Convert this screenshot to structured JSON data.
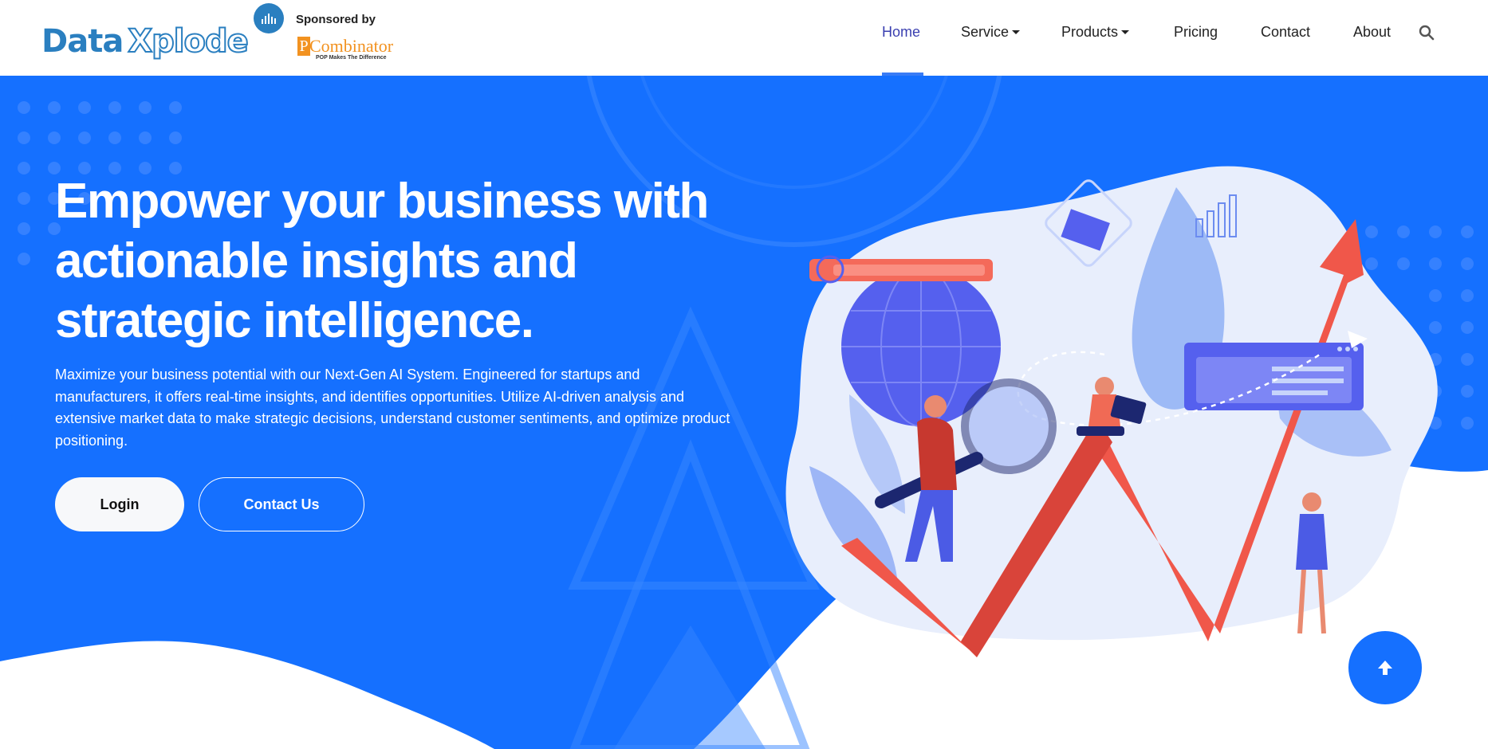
{
  "brand": {
    "logo_word1": "Data",
    "logo_word2": "Xplode",
    "sponsor_label": "Sponsored by",
    "sponsor_mark": "P",
    "sponsor_name": "Combinator",
    "sponsor_tagline": "POP Makes The Difference"
  },
  "nav": {
    "items": [
      {
        "label": "Home",
        "active": true
      },
      {
        "label": "Service",
        "dropdown": true
      },
      {
        "label": "Products",
        "dropdown": true
      },
      {
        "label": "Pricing"
      },
      {
        "label": "Contact"
      },
      {
        "label": "About"
      }
    ],
    "search_icon": "search-icon"
  },
  "hero": {
    "title_line1": "Empower your business with",
    "title_line2": "actionable insights and",
    "title_line3": "strategic intelligence.",
    "description": "Maximize your business potential with our Next-Gen AI System. Engineered for startups and manufacturers, it offers real-time insights, and identifies opportunities. Utilize AI-driven analysis and extensive market data to make strategic decisions, understand customer sentiments, and optimize product positioning.",
    "login_label": "Login",
    "contact_label": "Contact Us"
  },
  "scroll_top_icon": "arrow-up-icon",
  "colors": {
    "hero_blue": "#1570ff",
    "brand_blue": "#2a7fc0",
    "accent_red": "#f05a4a",
    "nav_active": "#3a3fb0",
    "sponsor_orange": "#f29220"
  }
}
